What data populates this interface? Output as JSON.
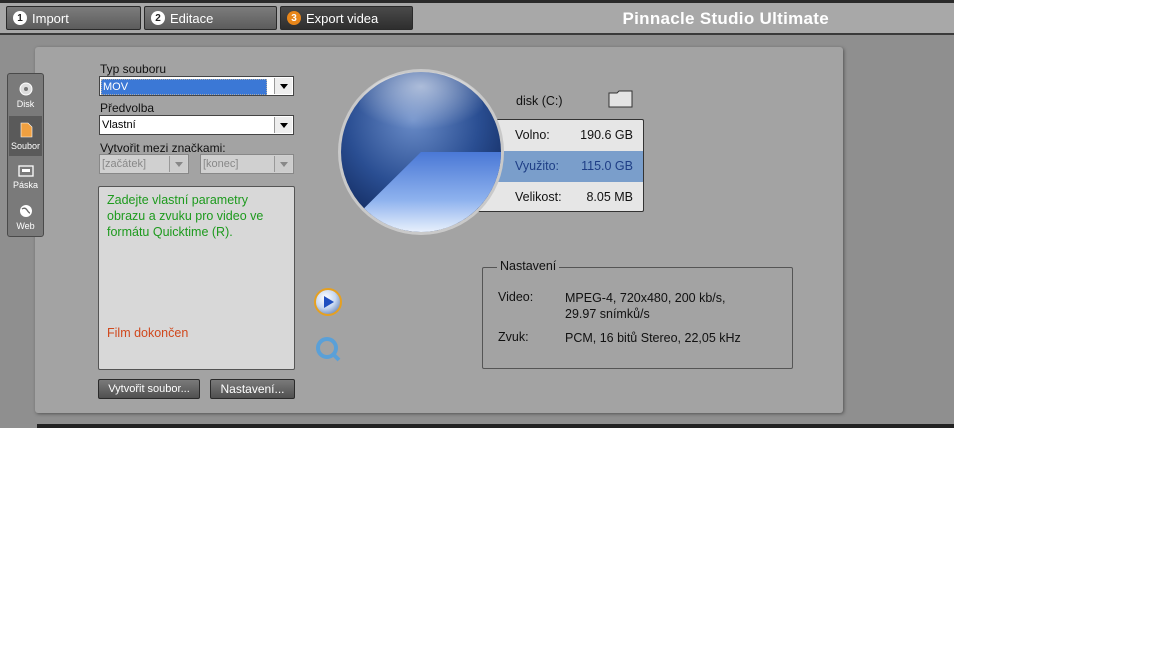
{
  "tabs": [
    {
      "num": "1",
      "label": "Import"
    },
    {
      "num": "2",
      "label": "Editace"
    },
    {
      "num": "3",
      "label": "Export videa"
    }
  ],
  "app_title": "Pinnacle Studio Ultimate",
  "sidebar": {
    "items": [
      {
        "label": "Disk",
        "icon": "disc-icon"
      },
      {
        "label": "Soubor",
        "icon": "file-icon",
        "selected": true
      },
      {
        "label": "Páska",
        "icon": "tape-icon"
      },
      {
        "label": "Web",
        "icon": "globe-icon"
      }
    ]
  },
  "form": {
    "file_type_label": "Typ souboru",
    "file_type_value": "MOV",
    "preset_label": "Předvolba",
    "preset_value": "Vlastní",
    "range_label": "Vytvořit mezi značkami:",
    "range_start": "[začátek]",
    "range_end": "[konec]"
  },
  "info": {
    "description": "Zadejte vlastní parametry obrazu a zvuku pro video ve formátu Quicktime (R).",
    "status": "Film dokončen"
  },
  "buttons": {
    "create_file": "Vytvořit soubor...",
    "settings": "Nastavení..."
  },
  "disk": {
    "label": "disk (C:)",
    "folder_icon": "folder-icon",
    "free_label": "Volno:",
    "free_value": "190.6 GB",
    "used_label": "Využito:",
    "used_value": "115.0 GB",
    "size_label": "Velikost:",
    "size_value": "8.05 MB",
    "used_fraction": 0.376
  },
  "settings": {
    "legend": "Nastavení",
    "video_label": "Video:",
    "video_value": "MPEG-4, 720x480, 200 kb/s, 29.97 snímků/s",
    "audio_label": "Zvuk:",
    "audio_value": "PCM, 16 bitů Stereo, 22,05 kHz"
  },
  "colors": {
    "accent": "#e8861a",
    "info_text": "#1d9a1d",
    "status_text": "#d0481d",
    "used_highlight": "#7a9ecb"
  }
}
